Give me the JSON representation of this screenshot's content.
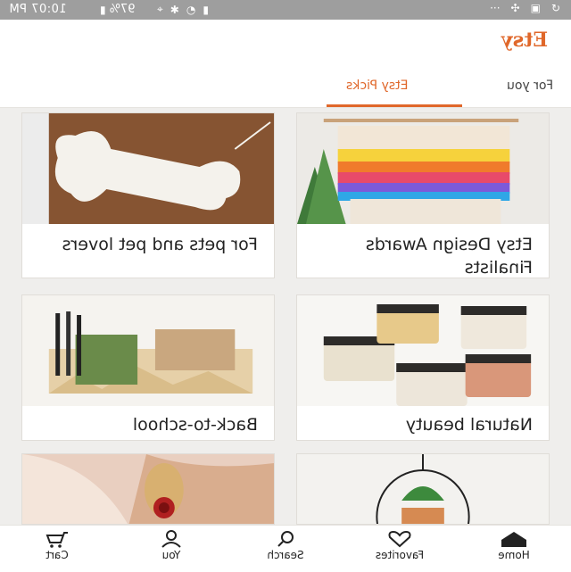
{
  "status_bar": {
    "time": "10:07 PM",
    "battery": "97%"
  },
  "header": {
    "logo": "Etsy"
  },
  "tabs": [
    {
      "label": "For you",
      "active": false
    },
    {
      "label": "Etsy Picks",
      "active": true
    }
  ],
  "cards": [
    {
      "title": "Etsy Design Awards Finalists",
      "image": "rainbow-wall-weaving"
    },
    {
      "title": "For pets and pet lovers",
      "image": "lulu-bone-ornament"
    },
    {
      "title": "Natural beauty",
      "image": "cosmetic-jars"
    },
    {
      "title": "Back-to-school",
      "image": "wooden-desk-organizer"
    },
    {
      "title": "",
      "image": "hanging-plant"
    },
    {
      "title": "",
      "image": "ornate-earring"
    }
  ],
  "bottom_nav": [
    {
      "label": "Home",
      "icon": "home-icon",
      "active": true
    },
    {
      "label": "Favorites",
      "icon": "heart-icon",
      "active": false
    },
    {
      "label": "Search",
      "icon": "search-icon",
      "active": false
    },
    {
      "label": "You",
      "icon": "person-icon",
      "active": false
    },
    {
      "label": "Cart",
      "icon": "cart-icon",
      "active": false
    }
  ],
  "colors": {
    "accent": "#e0672a",
    "status_bar": "#9e9e9e",
    "background": "#efeeec"
  }
}
